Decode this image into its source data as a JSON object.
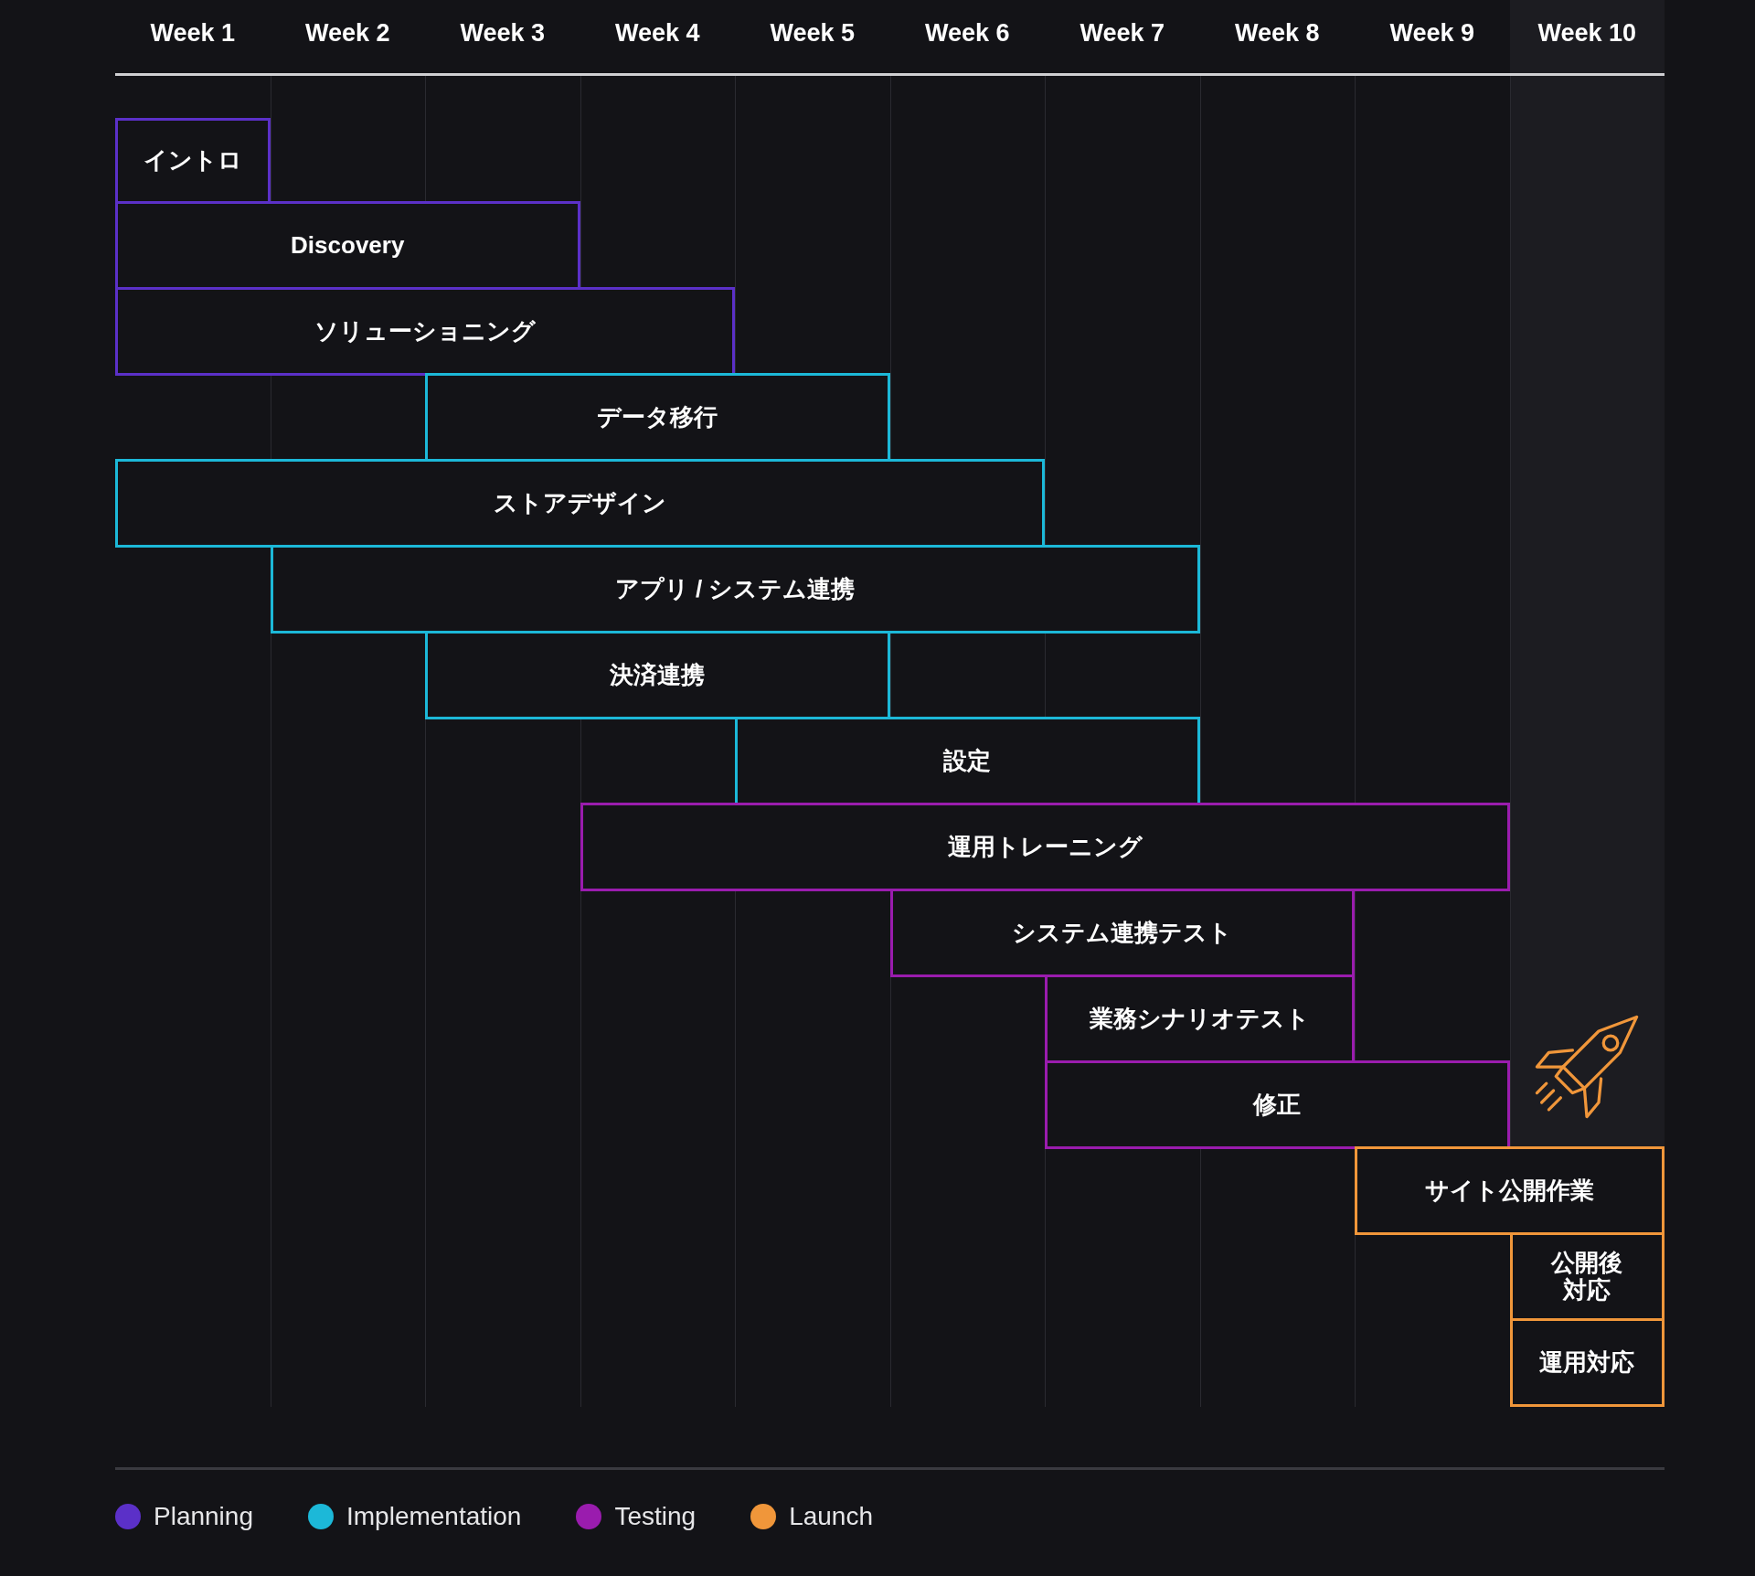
{
  "weeks": [
    "Week 1",
    "Week 2",
    "Week 3",
    "Week 4",
    "Week 5",
    "Week 6",
    "Week 7",
    "Week 8",
    "Week 9",
    "Week 10"
  ],
  "tasks": [
    {
      "lines": [
        "イントロ"
      ],
      "color": "#5b30c8"
    },
    {
      "lines": [
        "Discovery"
      ],
      "color": "#5b30c8"
    },
    {
      "lines": [
        "ソリューショニング"
      ],
      "color": "#5b30c8"
    },
    {
      "lines": [
        "データ移行"
      ],
      "color": "#1cb8d8"
    },
    {
      "lines": [
        "ストアデザイン"
      ],
      "color": "#1cb8d8"
    },
    {
      "lines": [
        "アプリ / システム連携"
      ],
      "color": "#1cb8d8"
    },
    {
      "lines": [
        "決済連携"
      ],
      "color": "#1cb8d8"
    },
    {
      "lines": [
        "設定"
      ],
      "color": "#1cb8d8"
    },
    {
      "lines": [
        "運用トレーニング"
      ],
      "color": "#9a1cae"
    },
    {
      "lines": [
        "システム連携テスト"
      ],
      "color": "#9a1cae"
    },
    {
      "lines": [
        "業務シナリオテスト"
      ],
      "color": "#9a1cae"
    },
    {
      "lines": [
        "修正"
      ],
      "color": "#9a1cae"
    },
    {
      "lines": [
        "サイト公開作業"
      ],
      "color": "#f0963a"
    },
    {
      "lines": [
        "公開後",
        "対応"
      ],
      "color": "#f0963a"
    },
    {
      "lines": [
        "運用対応"
      ],
      "color": "#f0963a"
    }
  ],
  "legend": [
    {
      "label": "Planning",
      "color": "#5b30c8"
    },
    {
      "label": "Implementation",
      "color": "#1cb8d8"
    },
    {
      "label": "Testing",
      "color": "#9a1cae"
    },
    {
      "label": "Launch",
      "color": "#f0963a"
    }
  ]
}
